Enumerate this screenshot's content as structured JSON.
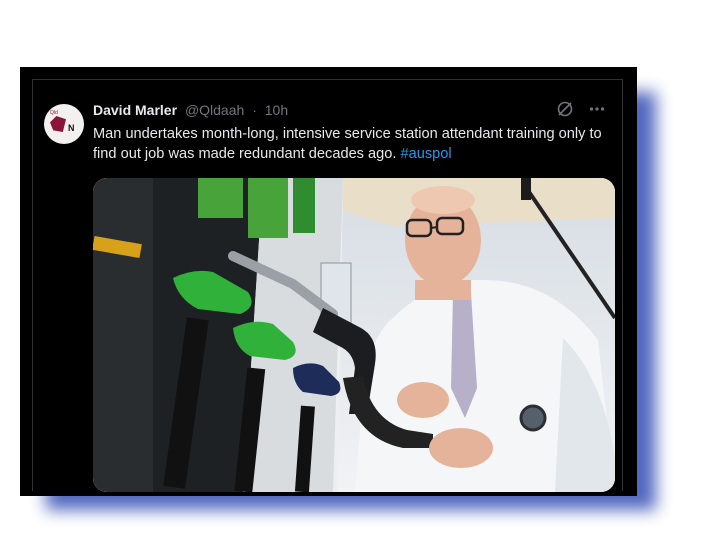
{
  "tweet": {
    "author_name": "David Marler",
    "handle": "@Qldaah",
    "separator": "·",
    "time": "10h",
    "text": "Man undertakes month-long, intensive service station attendant training only to find out job was made redundant decades ago.",
    "hashtag": "#auspol"
  },
  "icons": {
    "grok": "grok-icon",
    "more": "more-icon"
  },
  "colors": {
    "background": "#000000",
    "text": "#e7e9ea",
    "muted": "#71767b",
    "link": "#1d9bf0",
    "frame_shadow": "#3f58b8"
  }
}
